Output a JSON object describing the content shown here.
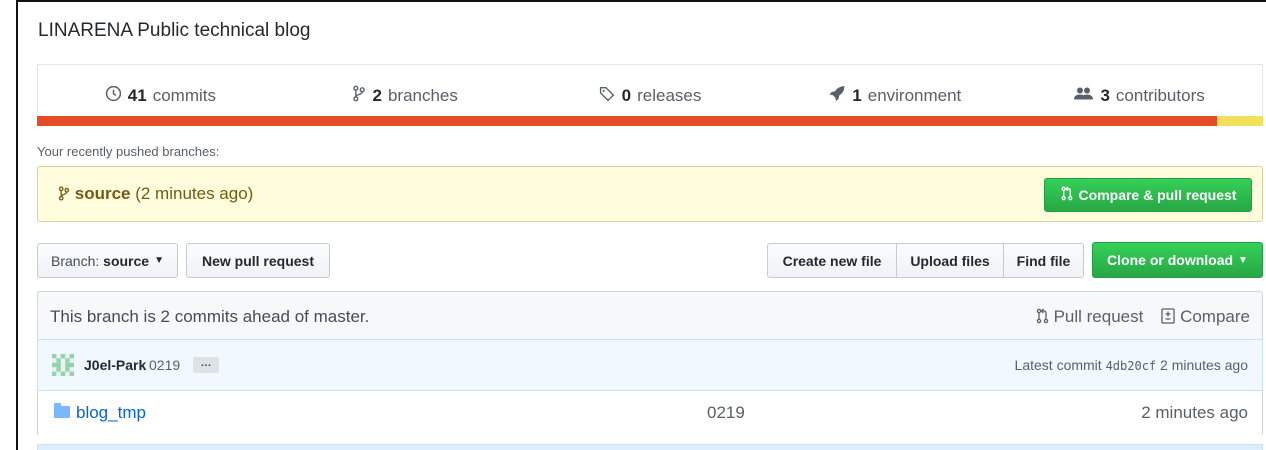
{
  "repo": {
    "description": "LINARENA Public technical blog"
  },
  "numbers": [
    {
      "icon": "history-icon",
      "count": "41",
      "label": "commits"
    },
    {
      "icon": "branch-icon",
      "count": "2",
      "label": "branches"
    },
    {
      "icon": "tag-icon",
      "count": "0",
      "label": "releases"
    },
    {
      "icon": "rocket-icon",
      "count": "1",
      "label": "environment"
    },
    {
      "icon": "people-icon",
      "count": "3",
      "label": "contributors"
    }
  ],
  "languages": [
    {
      "color": "#e34c26",
      "share": 0.962
    },
    {
      "color": "#f1e05a",
      "share": 0.038
    }
  ],
  "recent": {
    "label": "Your recently pushed branches:",
    "branch": "source",
    "time": "(2 minutes ago)",
    "compare_button": "Compare & pull request"
  },
  "file_nav": {
    "branch_prefix": "Branch:",
    "branch_name": "source",
    "new_pr": "New pull request",
    "create_file": "Create new file",
    "upload_files": "Upload files",
    "find_file": "Find file",
    "clone": "Clone or download"
  },
  "ahead": {
    "message": "This branch is 2 commits ahead of master.",
    "pull_request": "Pull request",
    "compare": "Compare"
  },
  "commit": {
    "author": "J0el-Park",
    "message": "0219",
    "expander": "…",
    "latest_prefix": "Latest commit",
    "sha": "4db20cf",
    "age": "2 minutes ago"
  },
  "files": [
    {
      "name": "blog_tmp",
      "message": "0219",
      "age": "2 minutes ago"
    }
  ],
  "colors": {
    "accent_green": "#2cbe4e",
    "link_blue": "#0366d6",
    "recent_bg": "#fffbdd"
  }
}
